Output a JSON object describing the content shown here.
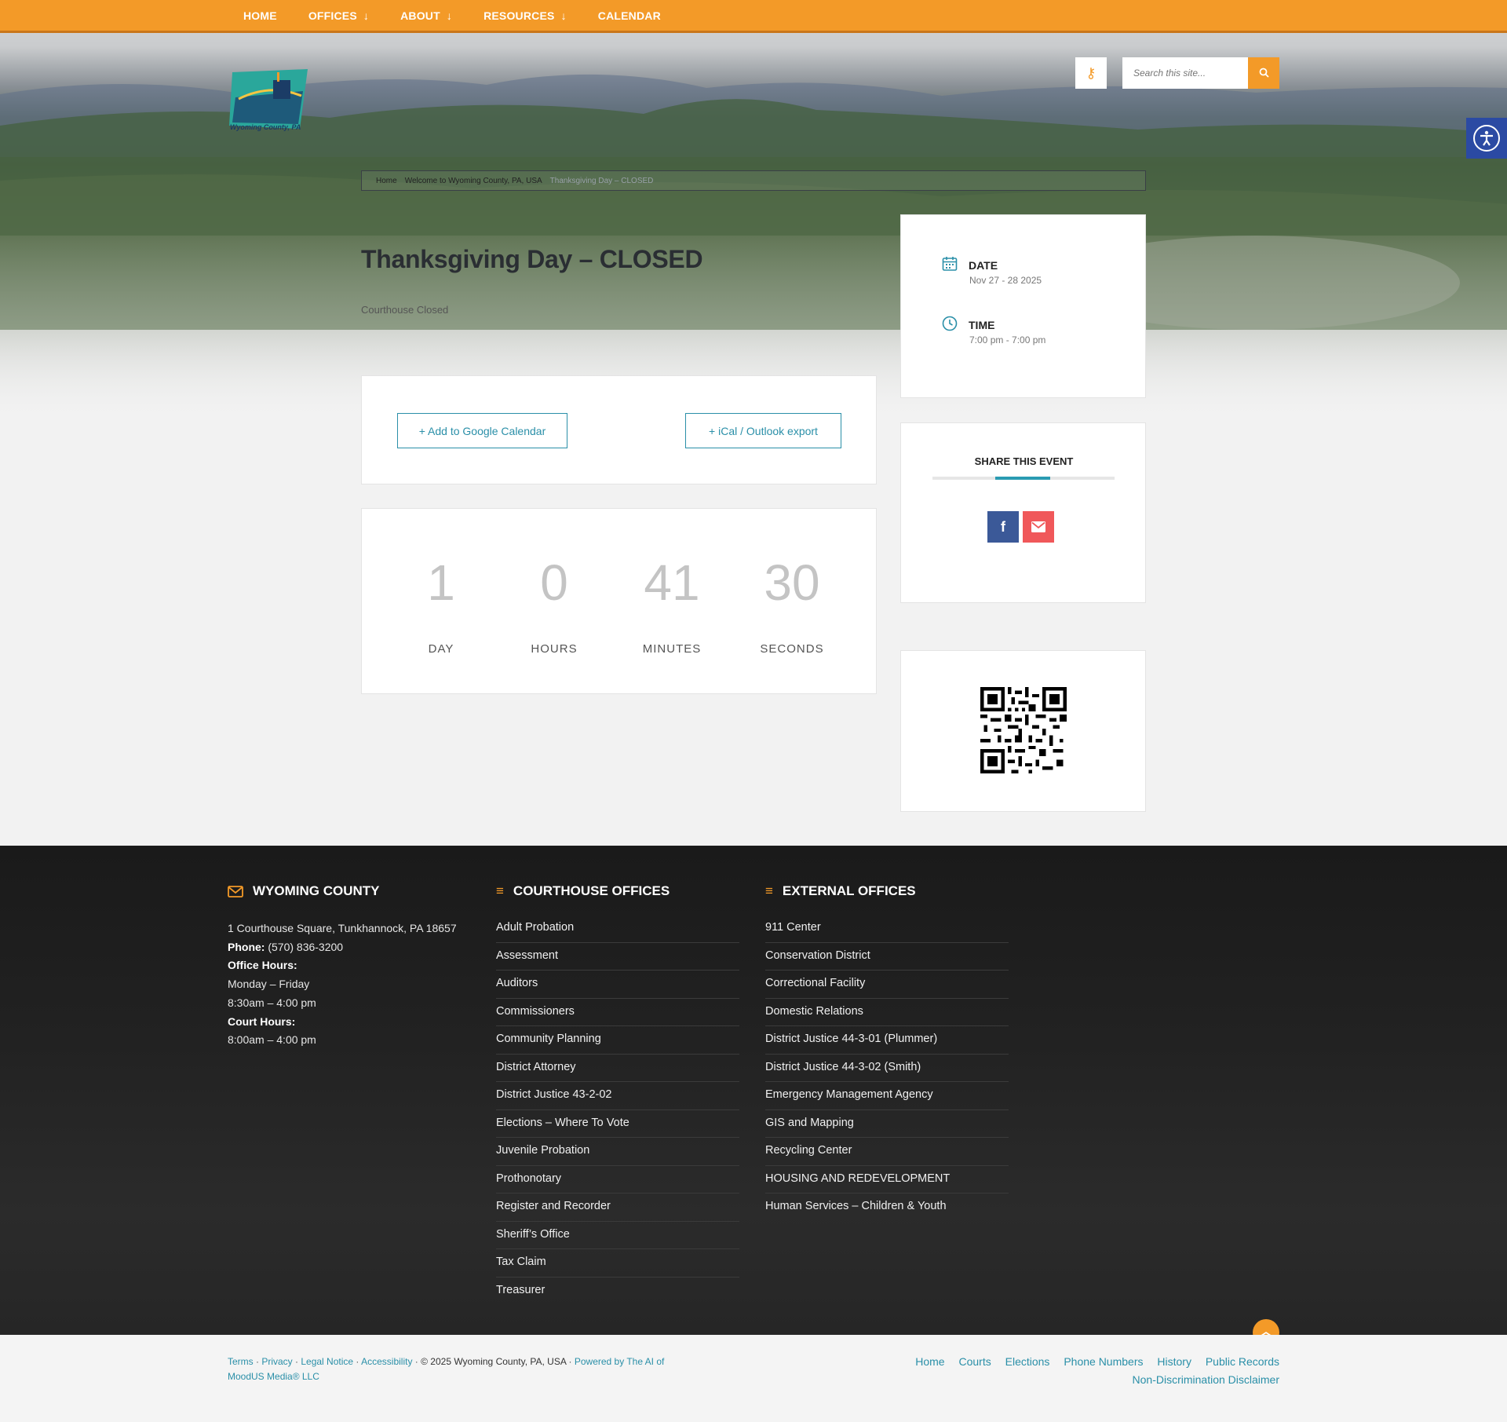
{
  "nav": {
    "items": [
      {
        "label": "HOME",
        "dropdown": false
      },
      {
        "label": "OFFICES",
        "dropdown": true
      },
      {
        "label": "ABOUT",
        "dropdown": true
      },
      {
        "label": "RESOURCES",
        "dropdown": true
      },
      {
        "label": "CALENDAR",
        "dropdown": false
      }
    ],
    "arrow": "↓"
  },
  "logo": {
    "text": "Wyoming County, PA"
  },
  "search": {
    "placeholder": "Search this site..."
  },
  "breadcrumb": {
    "home": "Home",
    "parent": "Welcome to Wyoming County, PA, USA",
    "current": "Thanksgiving Day – CLOSED"
  },
  "event": {
    "title": "Thanksgiving Day – CLOSED",
    "description": "Courthouse Closed",
    "date_label": "DATE",
    "date_value": "Nov 27 - 28 2025",
    "time_label": "TIME",
    "time_value": "7:00 pm - 7:00 pm"
  },
  "calendar_buttons": {
    "google": "+ Add to Google Calendar",
    "ical": "+ iCal / Outlook export"
  },
  "countdown": [
    {
      "value": "1",
      "unit": "DAY"
    },
    {
      "value": "0",
      "unit": "HOURS"
    },
    {
      "value": "41",
      "unit": "MINUTES"
    },
    {
      "value": "30",
      "unit": "SECONDS"
    }
  ],
  "share": {
    "title": "SHARE THIS EVENT"
  },
  "footer": {
    "col1": {
      "heading": "WYOMING COUNTY",
      "address": "1 Courthouse Square, Tunkhannock, PA 18657",
      "phone_label": "Phone:",
      "phone": "(570) 836-3200",
      "office_hours_label": "Office Hours:",
      "office_days": "Monday – Friday",
      "office_hours": "8:30am – 4:00 pm",
      "court_hours_label": "Court Hours:",
      "court_hours": "8:00am – 4:00 pm"
    },
    "col2": {
      "heading": "COURTHOUSE OFFICES",
      "items": [
        "Adult Probation",
        "Assessment",
        "Auditors",
        "Commissioners",
        "Community Planning",
        "District Attorney",
        "District Justice 43-2-02",
        "Elections – Where To Vote",
        "Juvenile Probation",
        "Prothonotary",
        "Register and Recorder",
        "Sheriff’s Office",
        "Tax Claim",
        "Treasurer"
      ]
    },
    "col3": {
      "heading": "EXTERNAL OFFICES",
      "items": [
        "911 Center",
        "Conservation District",
        "Correctional Facility",
        "Domestic Relations",
        "District Justice 44-3-01 (Plummer)",
        "District Justice 44-3-02 (Smith)",
        "Emergency Management Agency",
        "GIS and Mapping",
        "Recycling Center",
        "HOUSING AND REDEVELOPMENT",
        "Human Services – Children & Youth"
      ]
    }
  },
  "legal": {
    "terms": "Terms",
    "privacy": "Privacy",
    "legal_notice": "Legal Notice",
    "accessibility": "Accessibility",
    "copyright": "© 2025 Wyoming County, PA, USA",
    "powered": "Powered by The AI of MoodUS Media® LLC"
  },
  "bottom_links": {
    "row1": [
      "Home",
      "Courts",
      "Elections",
      "Phone Numbers",
      "History",
      "Public Records"
    ],
    "row2": "Non-Discrimination Disclaimer"
  },
  "icons": {
    "key": "key-icon",
    "search": "search-icon",
    "accessibility": "accessibility-icon",
    "calendar": "calendar-icon",
    "clock": "clock-icon",
    "facebook": "facebook-icon",
    "email": "email-icon",
    "envelope": "envelope-icon",
    "menu": "menu-icon",
    "chevron_up": "chevron-up-icon"
  },
  "colors": {
    "accent_orange": "#f39a28",
    "accent_teal": "#2a8fa8",
    "facebook": "#3b5998",
    "email": "#f0585a",
    "access_blue": "#2b4aa3"
  }
}
